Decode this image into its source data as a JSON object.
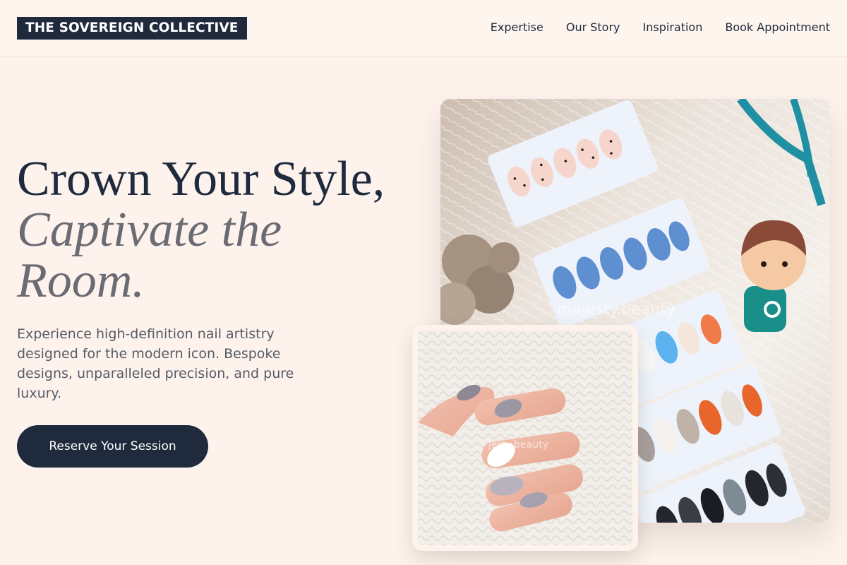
{
  "brand": {
    "name": "THE SOVEREIGN COLLECTIVE"
  },
  "nav": {
    "items": [
      {
        "label": "Expertise"
      },
      {
        "label": "Our Story"
      },
      {
        "label": "Inspiration"
      },
      {
        "label": "Book Appointment"
      }
    ]
  },
  "hero": {
    "title_line1": "Crown Your Style,",
    "title_line2": "Captivate the Room.",
    "description": "Experience high-definition nail artistry designed for the modern icon. Bespoke designs, unparalleled precision, and pure luxury.",
    "cta_label": "Reserve Your Session"
  },
  "images": {
    "main_watermark": "majesty.beauty",
    "inset_watermark": "jesty.beauty"
  },
  "colors": {
    "background": "#fdf3ec",
    "navy": "#1f2a3d",
    "muted_text": "#555b66",
    "italic_gray": "#6b6b73"
  }
}
